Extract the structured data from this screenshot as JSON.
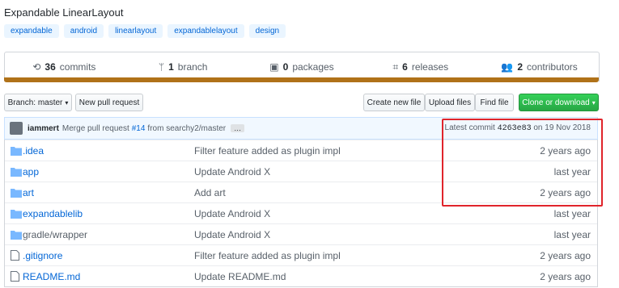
{
  "repo": {
    "description": "Expandable LinearLayout",
    "topics": [
      "expandable",
      "android",
      "linearlayout",
      "expandablelayout",
      "design"
    ]
  },
  "summary": {
    "commits": {
      "count": "36",
      "label": "commits"
    },
    "branch": {
      "count": "1",
      "label": "branch"
    },
    "packages": {
      "count": "0",
      "label": "packages"
    },
    "releases": {
      "count": "6",
      "label": "releases"
    },
    "contributors": {
      "count": "2",
      "label": "contributors"
    }
  },
  "toolbar": {
    "branch_label": "Branch: master",
    "new_pr": "New pull request",
    "create_file": "Create new file",
    "upload_files": "Upload files",
    "find_file": "Find file",
    "clone": "Clone or download"
  },
  "commit": {
    "author": "iammert",
    "message_prefix": "Merge pull request",
    "pr": "#14",
    "message_suffix": "from searchy2/master",
    "more": "…",
    "latest_label": "Latest commit",
    "sha": "4263e83",
    "date": "on 19 Nov 2018"
  },
  "files": [
    {
      "type": "folder",
      "name": ".idea",
      "message": "Filter feature added as plugin impl",
      "age": "2 years ago"
    },
    {
      "type": "folder",
      "name": "app",
      "message": "Update Android X",
      "age": "last year"
    },
    {
      "type": "folder",
      "name": "art",
      "message": "Add art",
      "age": "2 years ago"
    },
    {
      "type": "folder",
      "name": "expandablelib",
      "message": "Update Android X",
      "age": "last year"
    },
    {
      "type": "folder",
      "name": "gradle/wrapper",
      "message": "Update Android X",
      "age": "last year"
    },
    {
      "type": "file",
      "name": ".gitignore",
      "message": "Filter feature added as plugin impl",
      "age": "2 years ago"
    },
    {
      "type": "file",
      "name": "README.md",
      "message": "Update README.md",
      "age": "2 years ago"
    }
  ],
  "colors": {
    "language_bar": "#b07219",
    "highlight": "#e0242b"
  }
}
